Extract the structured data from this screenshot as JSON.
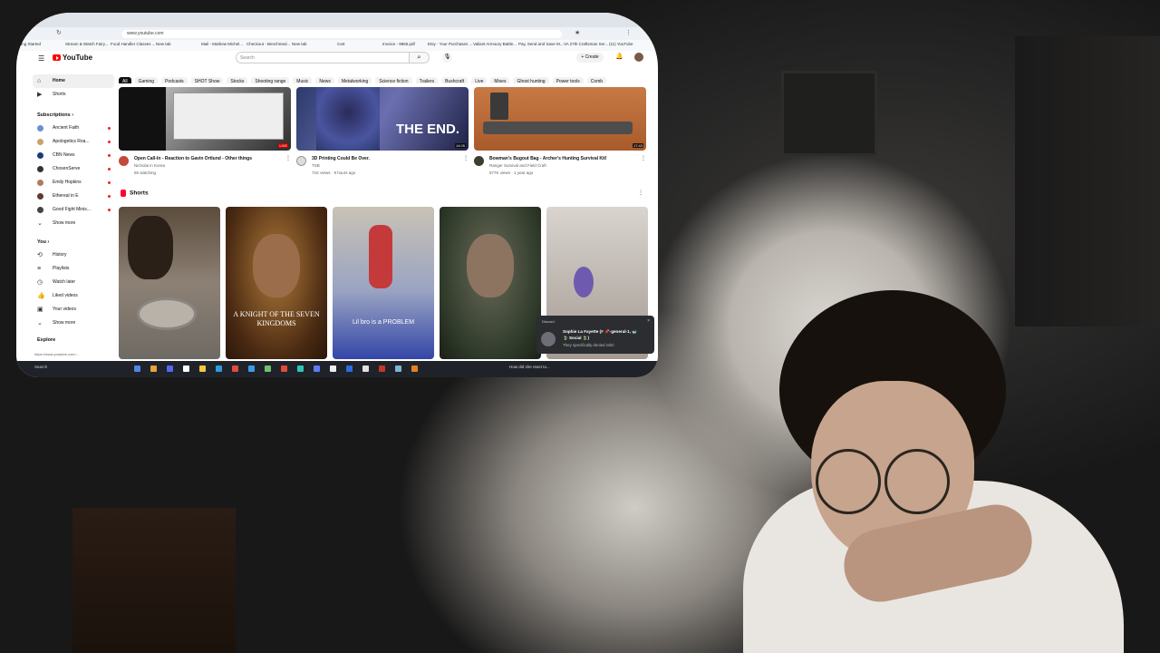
{
  "browser": {
    "url": "www.youtube.com",
    "bookmarks": [
      "ting Started",
      "Stream & Watch Fairy...",
      "Food Handler Classes ...",
      "New tab",
      "Mail - Mathew Michel...",
      "Checkout - Benchmed...",
      "New tab",
      "Cart",
      "Invoice - 9865.pdf",
      "Etsy - Your Purchases ...",
      "Valiant Armoury Battle...",
      "Pay, Send and Save M...",
      "VA 27th Craftsman Ser...",
      "(11) YouTube"
    ]
  },
  "youtube": {
    "logo": "YouTube",
    "search_placeholder": "Search",
    "create_label": "Create",
    "notif_count": "9+",
    "chips": [
      "All",
      "Gaming",
      "Podcasts",
      "SHOT Show",
      "Stocks",
      "Shooting range",
      "Music",
      "News",
      "Metalworking",
      "Science fiction",
      "Trailers",
      "Bushcraft",
      "Live",
      "Mixes",
      "Ghost hunting",
      "Power tools",
      "Comb"
    ],
    "sidebar": {
      "home": "Home",
      "shorts": "Shorts",
      "subscriptions_label": "Subscriptions",
      "subscriptions": [
        {
          "name": "Ancient Faith",
          "color": "#6a8fd6"
        },
        {
          "name": "Apologetics Roa...",
          "color": "#c9a36b"
        },
        {
          "name": "CBN News",
          "color": "#1c3b7a"
        },
        {
          "name": "ChosenServe",
          "color": "#333333"
        },
        {
          "name": "Emily Hopkins",
          "color": "#b07b5a"
        },
        {
          "name": "Ethereal in E",
          "color": "#5e3b2a"
        },
        {
          "name": "Good Fight Minis...",
          "color": "#444444"
        }
      ],
      "show_more": "Show more",
      "you_label": "You",
      "you_items": [
        "History",
        "Playlists",
        "Watch later",
        "Liked videos",
        "Your videos",
        "Show more"
      ],
      "explore_label": "Explore",
      "status_url": "https://www.youtube.com/..."
    },
    "videos": [
      {
        "title": "Open Call-In - Reaction to Gavin Ortlund - Other things",
        "channel": "Nicholai in Korea",
        "meta": "55 watching",
        "badge": "LIVE"
      },
      {
        "title": "3D Printing Could Be Over.",
        "channel": "TSB",
        "meta": "71K views · 9 hours ago",
        "duration": "14:05",
        "thumb_text": "THE END."
      },
      {
        "title": "Bowman's Bugout Bag - Archer's Hunting Survival Kit!",
        "channel": "Ranger Survival and Field Craft",
        "meta": "577K views · 1 year ago",
        "duration": "17:43"
      }
    ],
    "shorts_label": "Shorts",
    "shorts": [
      {
        "caption": ""
      },
      {
        "caption": "A KNIGHT OF THE SEVEN KINGDOMS"
      },
      {
        "caption": "Lil bro is a PROBLEM"
      },
      {
        "caption": ""
      },
      {
        "caption": ""
      }
    ]
  },
  "discord_toast": {
    "app": "Discord",
    "title_line1": "Sophie La Fayette (# 📌-general-1, 🐋",
    "title_line2": "🍃 Social 🍃)",
    "body": "They specifically denied rahri"
  },
  "taskbar": {
    "search": "Search",
    "now_playing": "How did she react to..."
  }
}
